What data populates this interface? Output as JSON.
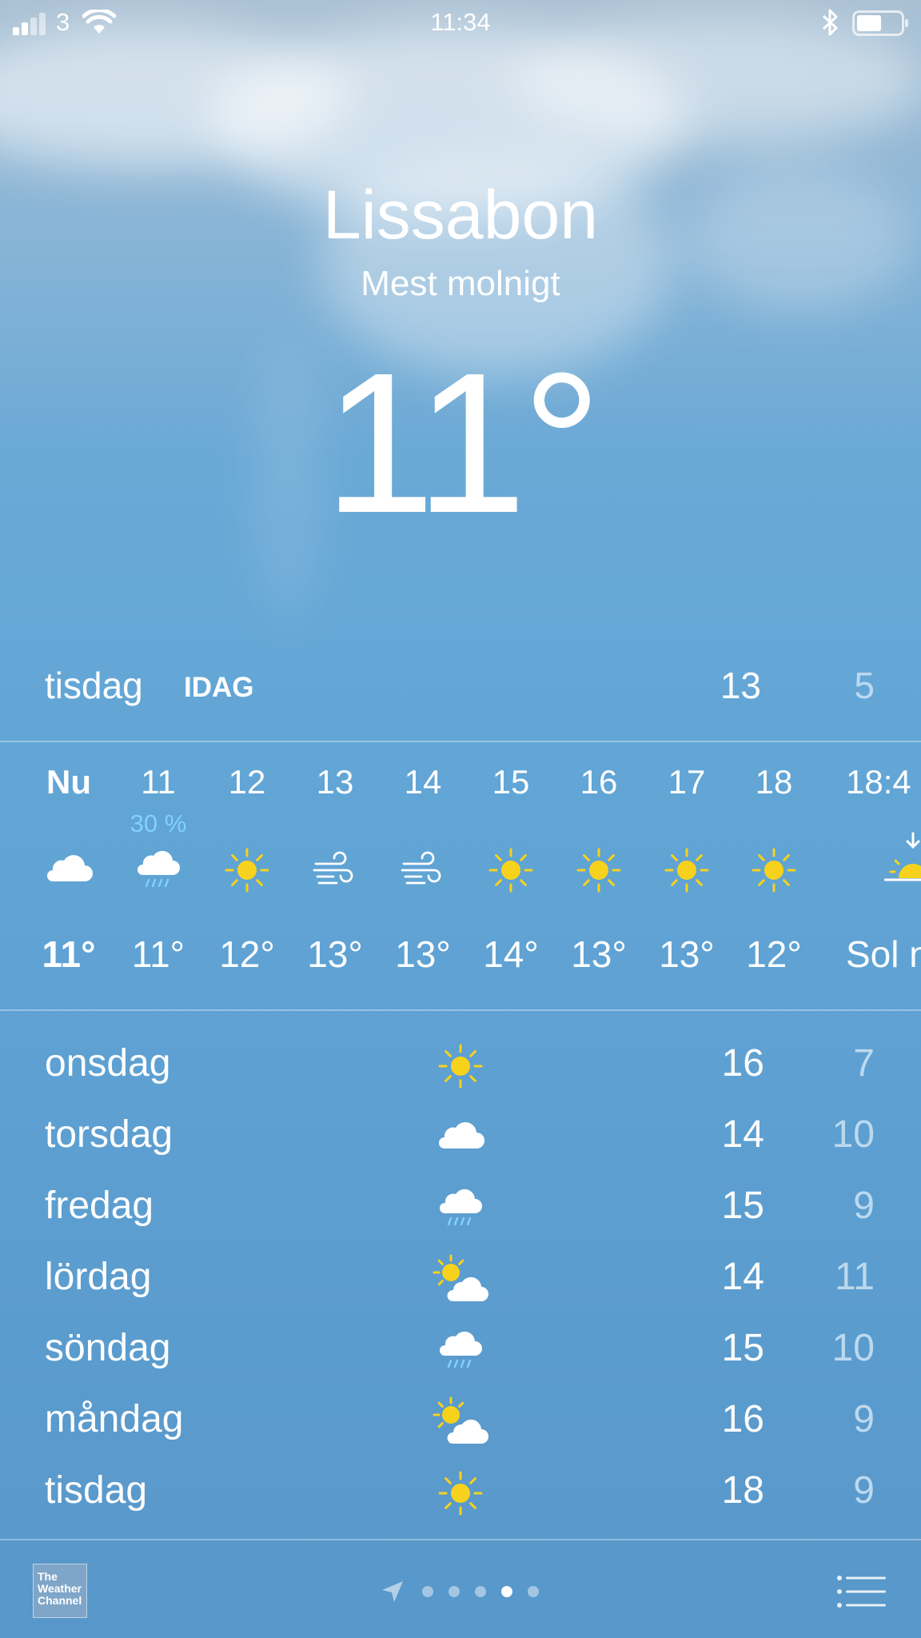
{
  "status_bar": {
    "carrier": "3",
    "time": "11:34"
  },
  "location": {
    "city": "Lissabon",
    "condition": "Mest molnigt",
    "temperature": "11°"
  },
  "today": {
    "day": "tisdag",
    "tag": "IDAG",
    "high": "13",
    "low": "5"
  },
  "hourly": [
    {
      "label": "Nu",
      "icon": "cloud-icon",
      "temp": "11°",
      "precip": ""
    },
    {
      "label": "11",
      "icon": "rain-cloud-icon",
      "temp": "11°",
      "precip": "30 %"
    },
    {
      "label": "12",
      "icon": "sun-icon",
      "temp": "12°",
      "precip": ""
    },
    {
      "label": "13",
      "icon": "wind-icon",
      "temp": "13°",
      "precip": ""
    },
    {
      "label": "14",
      "icon": "wind-icon",
      "temp": "13°",
      "precip": ""
    },
    {
      "label": "15",
      "icon": "sun-icon",
      "temp": "14°",
      "precip": ""
    },
    {
      "label": "16",
      "icon": "sun-icon",
      "temp": "13°",
      "precip": ""
    },
    {
      "label": "17",
      "icon": "sun-icon",
      "temp": "13°",
      "precip": ""
    },
    {
      "label": "18",
      "icon": "sun-icon",
      "temp": "12°",
      "precip": ""
    },
    {
      "label": "18:4",
      "icon": "sunset-icon",
      "temp": "Sol n",
      "precip": ""
    }
  ],
  "daily": [
    {
      "day": "onsdag",
      "icon": "sun-icon",
      "high": "16",
      "low": "7"
    },
    {
      "day": "torsdag",
      "icon": "cloud-icon",
      "high": "14",
      "low": "10"
    },
    {
      "day": "fredag",
      "icon": "rain-cloud-icon",
      "high": "15",
      "low": "9"
    },
    {
      "day": "lördag",
      "icon": "partly-cloudy-icon",
      "high": "14",
      "low": "11"
    },
    {
      "day": "söndag",
      "icon": "rain-cloud-icon",
      "high": "15",
      "low": "10"
    },
    {
      "day": "måndag",
      "icon": "partly-cloudy-icon",
      "high": "16",
      "low": "9"
    },
    {
      "day": "tisdag",
      "icon": "sun-icon",
      "high": "18",
      "low": "9"
    }
  ],
  "bottom_bar": {
    "logo_text": "The Weather Channel",
    "pages": 5,
    "active_page": 4
  },
  "colors": {
    "sun": "#f7d21c",
    "precip": "#7fd1ff",
    "low_temp": "#bcd9ef"
  }
}
